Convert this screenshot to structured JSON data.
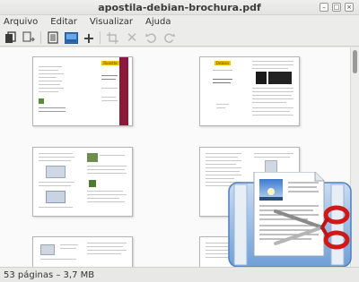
{
  "window": {
    "title": "apostila-debian-brochura.pdf"
  },
  "menu": {
    "items": [
      "Arquivo",
      "Editar",
      "Visualizar",
      "Ajuda"
    ]
  },
  "toolbar": {
    "icons": [
      "copy-icon",
      "export-icon",
      "list-view-icon",
      "image-view-icon",
      "add-icon",
      "crop-icon",
      "delete-icon",
      "rotate-left-icon",
      "rotate-right-icon"
    ]
  },
  "page_thumb_text": {
    "p1_logo": "Rosetta",
    "p2_logo": "Debian"
  },
  "status": {
    "text": "53 páginas – 3,7 MB"
  },
  "colors": {
    "accent_bar": "#8b1a3a",
    "logo_yellow": "#e7c400"
  }
}
